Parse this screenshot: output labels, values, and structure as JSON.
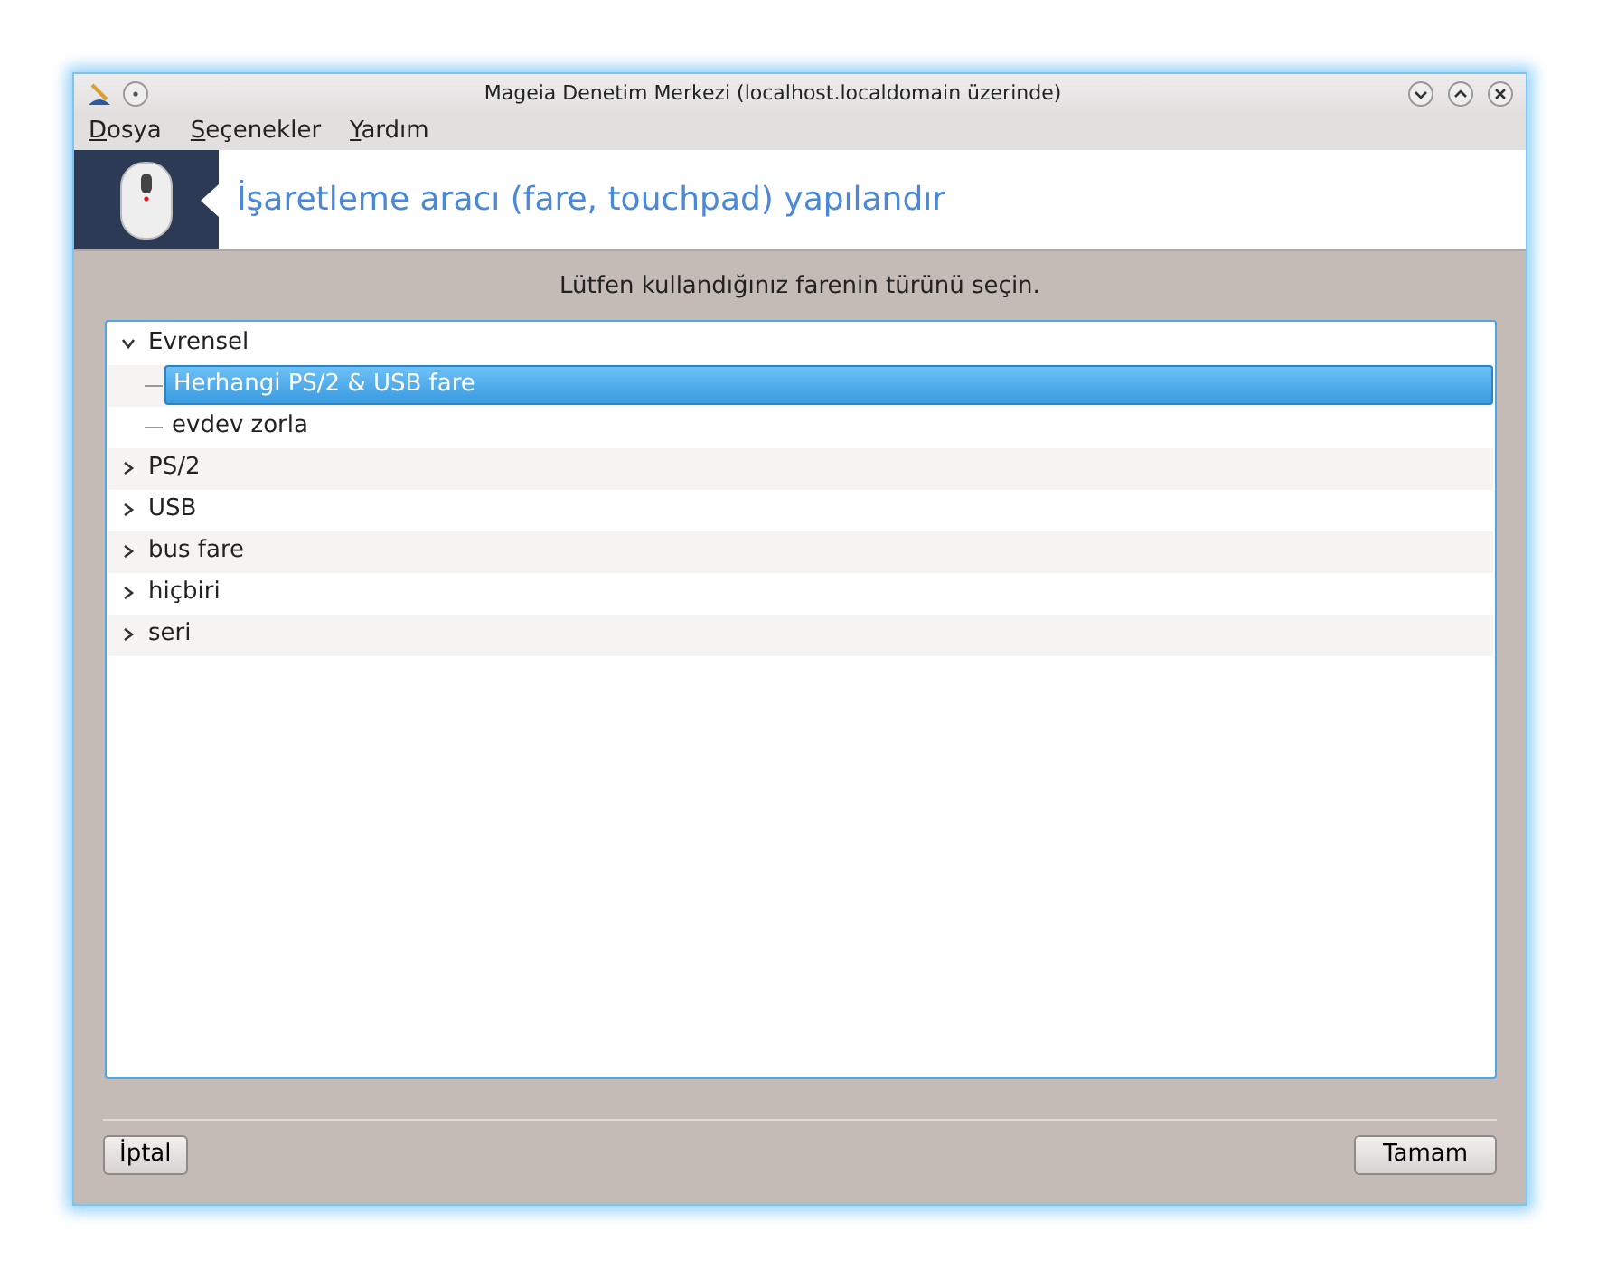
{
  "window": {
    "title": "Mageia Denetim Merkezi  (localhost.localdomain üzerinde)"
  },
  "menu": [
    "Dosya",
    "Seçenekler",
    "Yardım"
  ],
  "banner": {
    "title": "İşaretleme aracı (fare, touchpad) yapılandır"
  },
  "instruction": "Lütfen kullandığınız farenin türünü seçin.",
  "tree": [
    {
      "label": "Evrensel",
      "expanded": true,
      "selected": false,
      "children": [
        {
          "label": "Herhangi PS/2 & USB fare",
          "selected": true
        },
        {
          "label": "evdev zorla",
          "selected": false
        }
      ]
    },
    {
      "label": "PS/2",
      "expanded": false,
      "selected": false
    },
    {
      "label": "USB",
      "expanded": false,
      "selected": false
    },
    {
      "label": "bus fare",
      "expanded": false,
      "selected": false
    },
    {
      "label": "hiçbiri",
      "expanded": false,
      "selected": false
    },
    {
      "label": "seri",
      "expanded": false,
      "selected": false
    }
  ],
  "buttons": [
    "İptal",
    "Tamam"
  ]
}
